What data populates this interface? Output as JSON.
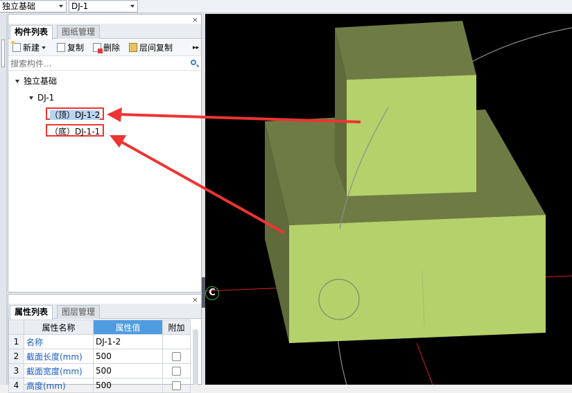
{
  "combos": {
    "type_value": "独立基础",
    "component_value": "DJ-1"
  },
  "component_panel": {
    "tabs": [
      "构件列表",
      "图纸管理"
    ],
    "toolbar": {
      "new": "新建",
      "copy": "复制",
      "delete": "删除",
      "layer_copy": "层间复制",
      "more": "▸▸"
    },
    "search_placeholder": "搜索构件...",
    "tree": {
      "root": "独立基础",
      "group": "DJ-1",
      "items": [
        {
          "label": "（顶）DJ-1-2",
          "selected": true
        },
        {
          "label": "（底）DJ-1-1",
          "selected": false
        }
      ]
    }
  },
  "property_panel": {
    "tabs": [
      "属性列表",
      "图层管理"
    ],
    "headers": [
      "属性名称",
      "属性值",
      "附加"
    ],
    "rows": [
      {
        "num": "1",
        "name": "名称",
        "value": "DJ-1-2",
        "has_check": false
      },
      {
        "num": "2",
        "name": "截面长度(mm)",
        "value": "500",
        "has_check": true
      },
      {
        "num": "3",
        "name": "截面宽度(mm)",
        "value": "500",
        "has_check": true
      },
      {
        "num": "4",
        "name": "高度(mm)",
        "value": "500",
        "has_check": true
      }
    ]
  },
  "viewport": {
    "badge": "C"
  },
  "colors": {
    "block_front": "#b5d16b",
    "block_side": "#6f7b45",
    "annotation": "#ee3333",
    "highlight_header": "#4f9de0"
  },
  "close_symbol": "×"
}
